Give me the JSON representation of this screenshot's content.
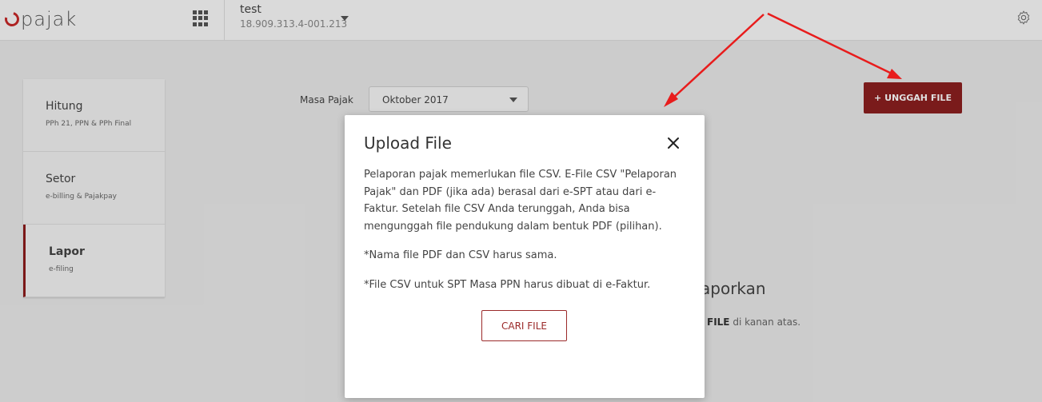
{
  "header": {
    "logo_text": "pajak",
    "company_name": "test",
    "company_npwp": "18.909.313.4-001.213"
  },
  "sidebar": {
    "items": [
      {
        "title": "Hitung",
        "subtitle": "PPh 21, PPN & PPh Final"
      },
      {
        "title": "Setor",
        "subtitle": "e-billing & Pajakpay"
      },
      {
        "title": "Lapor",
        "subtitle": "e-filing"
      }
    ]
  },
  "filter": {
    "masa_label": "Masa Pajak",
    "masa_value": "Oktober 2017"
  },
  "toolbar": {
    "upload_label": "+ UNGGAH FILE"
  },
  "background": {
    "heading_fragment": "aporkan",
    "hint_bold": "FILE",
    "hint_rest": " di kanan atas."
  },
  "modal": {
    "title": "Upload File",
    "paragraphs": [
      "Pelaporan pajak memerlukan file CSV. E-File CSV \"Pelaporan Pajak\" dan PDF (jika ada) berasal dari e-SPT atau dari e-Faktur. Setelah file CSV Anda terunggah, Anda bisa mengunggah file pendukung dalam bentuk PDF (pilihan).",
      "*Nama file PDF dan CSV harus sama.",
      "*File CSV untuk SPT Masa PPN harus dibuat di e-Faktur."
    ],
    "button_label": "CARI FILE"
  },
  "colors": {
    "brand_red": "#8b1f1f",
    "annotation_red": "#e81c1c"
  }
}
